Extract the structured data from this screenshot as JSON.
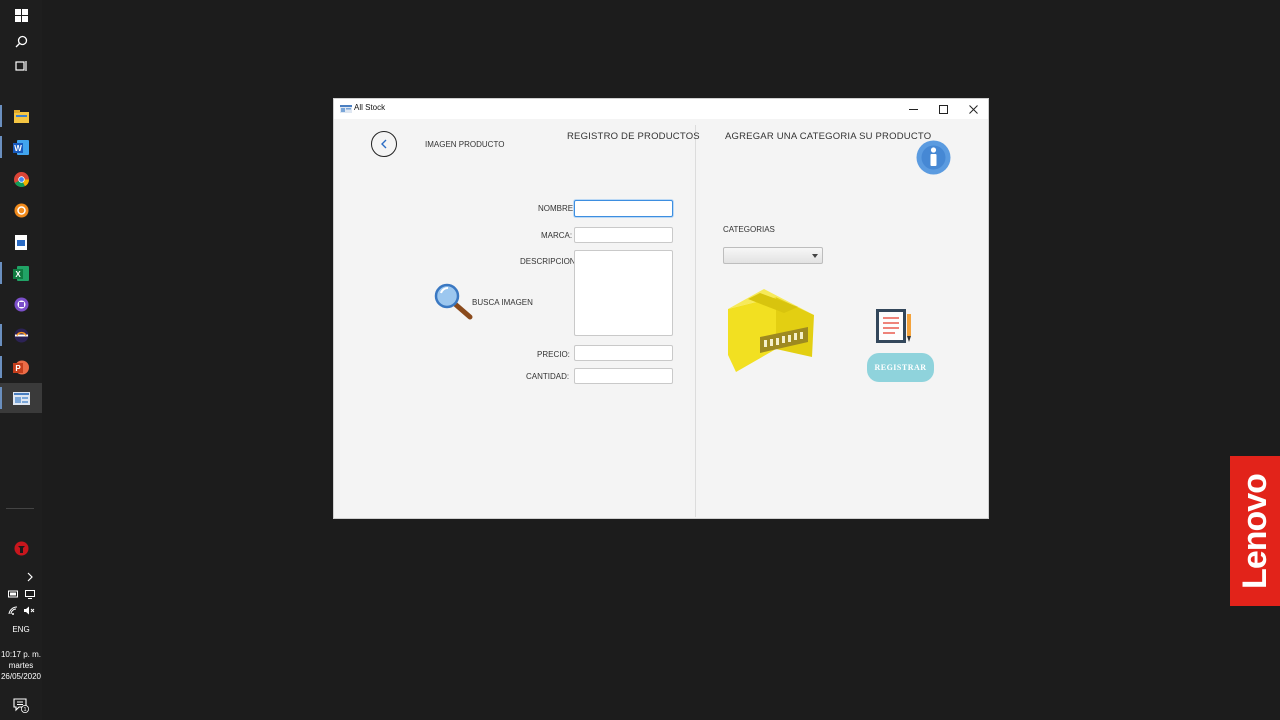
{
  "window": {
    "title": "All Stock",
    "controls": {
      "minimize": "—",
      "maximize": "☐",
      "close": "✕"
    }
  },
  "form": {
    "image_label": "IMAGEN PRODUCTO",
    "heading": "REGISTRO DE PRODUCTOS",
    "search_image_label": "BUSCA IMAGEN",
    "fields": {
      "nombre": {
        "label": "NOMBRE:",
        "value": ""
      },
      "marca": {
        "label": "MARCA:",
        "value": ""
      },
      "descripcion": {
        "label": "DESCRIPCION:",
        "value": ""
      },
      "precio": {
        "label": "PRECIO:",
        "value": ""
      },
      "cantidad": {
        "label": "CANTIDAD:",
        "value": ""
      }
    }
  },
  "category_panel": {
    "heading": "AGREGAR UNA CATEGORIA SU PRODUCTO",
    "categories_label": "CATEGORIAS",
    "selected_category": "",
    "register_button": "REGISTRAR"
  },
  "taskbar": {
    "language": "ENG",
    "time": "10:17 p. m.",
    "day": "martes",
    "date": "26/05/2020",
    "notification_count": "1"
  },
  "brand_badge": "Lenovo",
  "colors": {
    "accent_focus": "#3d8ee0",
    "register_button": "#8fd3dc",
    "info_icon": "#5b9be0",
    "box_yellow": "#f2e021",
    "lenovo_red": "#e2231a"
  }
}
